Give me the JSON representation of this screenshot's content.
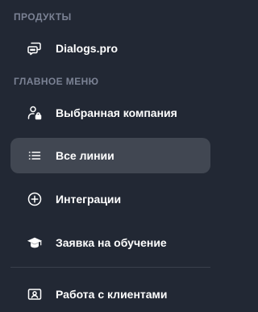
{
  "sections": {
    "products": {
      "heading": "ПРОДУКТЫ",
      "items": [
        {
          "label": "Dialogs.pro",
          "icon": "chat-bubbles-icon",
          "active": false
        }
      ]
    },
    "main_menu": {
      "heading": "ГЛАВНОЕ МЕНЮ",
      "items": [
        {
          "label": "Выбранная компания",
          "icon": "user-lock-icon",
          "active": false
        },
        {
          "label": "Все линии",
          "icon": "list-icon",
          "active": true
        },
        {
          "label": "Интеграции",
          "icon": "plus-circle-icon",
          "active": false
        },
        {
          "label": "Заявка на обучение",
          "icon": "graduation-cap-icon",
          "active": false
        }
      ]
    },
    "below_divider": {
      "items": [
        {
          "label": "Работа с клиентами",
          "icon": "contact-card-icon",
          "active": false
        }
      ]
    }
  },
  "colors": {
    "background": "#222834",
    "active_item": "#414752",
    "section_heading": "#7b8294",
    "text": "#ffffff",
    "divider": "#3a404c"
  }
}
